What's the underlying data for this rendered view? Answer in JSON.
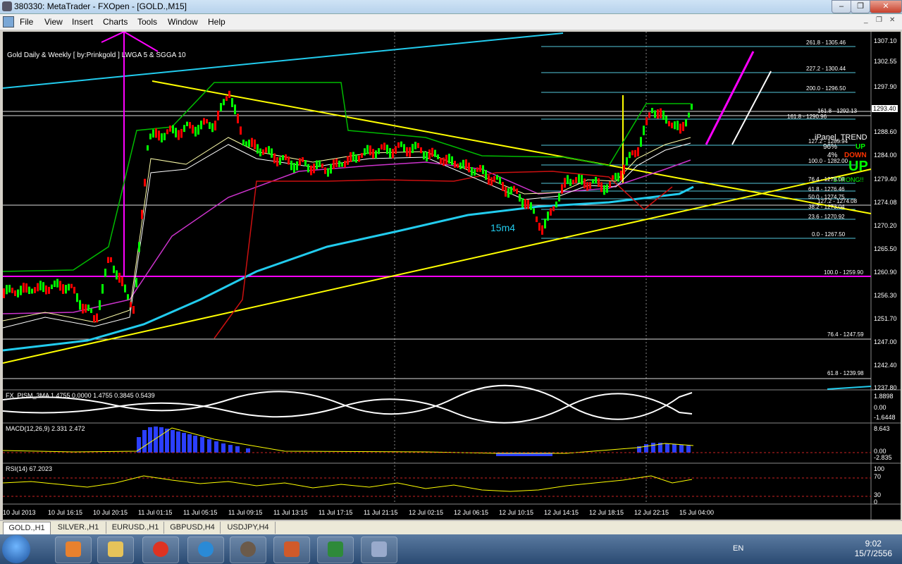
{
  "window": {
    "title": "380330: MetaTrader - FXOpen - [GOLD.,M15]",
    "controls": [
      "–",
      "❐",
      "✕"
    ],
    "mdi_controls": [
      "_",
      "❐",
      "✕"
    ]
  },
  "menu": [
    "File",
    "View",
    "Insert",
    "Charts",
    "Tools",
    "Window",
    "Help"
  ],
  "chart": {
    "header": "Gold Daily & Weekly [ by:Prinkgold ] LWGA 5 & SGGA 10",
    "price_axis": [
      "1307.10",
      "1302.55",
      "1297.90",
      "1293.40",
      "1288.60",
      "1284.00",
      "1279.40",
      "1274.08",
      "1270.20",
      "1265.50",
      "1260.90",
      "1256.30",
      "1251.70",
      "1247.00",
      "1242.40",
      "1237.80"
    ],
    "current_price": "1293.40",
    "fib_labels": [
      "261.8 - 1305.46",
      "227.2 - 1300.44",
      "200.0 - 1296.50",
      "161.8 - 1292.13",
      "161.8 - 1290.96",
      "127.2 - 1285.94",
      "100.0 - 1282.00",
      "76.4 - 1278.08",
      "61.8 - 1276.46",
      "50.0 - 1274.75",
      "127.2 - 1274.08",
      "38.2 - 1273.04",
      "23.6 - 1270.92",
      "0.0 - 1267.50",
      "100.0 - 1259.90",
      "76.4 - 1247.59",
      "61.8 - 1239.98"
    ],
    "ipanel": {
      "title": "iPanel_TREND",
      "up_pct": "96%",
      "up_label": "UP",
      "down_pct": "4%",
      "down_label": "DOWN",
      "big": "UP",
      "strong": "STRONG!!"
    },
    "annotation": "15m4",
    "time_axis": [
      "10 Jul 2013",
      "10 Jul 16:15",
      "10 Jul 20:15",
      "11 Jul 01:15",
      "11 Jul 05:15",
      "11 Jul 09:15",
      "11 Jul 13:15",
      "11 Jul 17:15",
      "11 Jul 21:15",
      "12 Jul 02:15",
      "12 Jul 06:15",
      "12 Jul 10:15",
      "12 Jul 14:15",
      "12 Jul 18:15",
      "12 Jul 22:15",
      "15 Jul 04:00"
    ],
    "ind1_label": "FX_PISM_3MA 1.4755 0.0000 1.4755 0.3845 0.5439",
    "ind1_axis": [
      "1.8898",
      "0.00",
      "-1.6448"
    ],
    "macd_label": "MACD(12,26,9) 2.331 2.472",
    "macd_axis": [
      "8.643",
      "0.00",
      "-2.835"
    ],
    "rsi_label": "RSI(14) 67.2023",
    "rsi_axis": [
      "100",
      "70",
      "30",
      "0"
    ]
  },
  "tabs": [
    "GOLD.,H1",
    "SILVER.,H1",
    "EURUSD.,H1",
    "GBPUSD,H4",
    "USDJPY,H4"
  ],
  "taskbar": {
    "lang": "EN",
    "time": "9:02",
    "date": "15/7/2556"
  },
  "colors": {
    "bull": "#00ff00",
    "bear": "#ff0000",
    "trend": "#ffff00",
    "ma_cyan": "#00ccee",
    "magenta": "#ff00ff"
  }
}
